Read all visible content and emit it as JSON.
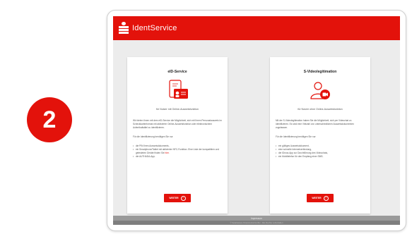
{
  "step": {
    "number": "2"
  },
  "colors": {
    "accent": "#e3120b",
    "page_bg": "#ececec",
    "footer_bg": "#9a9a9a"
  },
  "header": {
    "brand": "IdentService",
    "logo_icon": "sparkasse-logo-icon"
  },
  "cards": [
    {
      "title": "eID-Service",
      "icon": "id-card-icon",
      "subtitle": "für Nutzer mit Online-Ausweisfunktion",
      "paragraph1": "Wir bieten Ihnen mit dem eID-Service die Möglichkeit, sich mit Ihrem Personalausweis im Scheckkartenformat mit aktivierter Online-Ausweisfunktion oder elektronischem Aufenthaltstitel zu identifizieren.",
      "paragraph2": "Für die Identifizierung benötigen Sie nur",
      "list": [
        "die PIN Ihres Ausweisdokuments,",
        "ein Smartphone/Tablet mit aktivierter NFC-Funktion. Eine Liste der kompatiblen und getesteten Geräte finden Sie",
        "die AUTHADA-App."
      ],
      "link_text": "hier",
      "button_label": "WEITER"
    },
    {
      "title": "S-Videolegitimation",
      "icon": "video-user-icon",
      "subtitle": "für Nutzer ohne Online-Ausweisfunktion",
      "paragraph1": "Mit der S-Videolegitimation haben Sie die Möglichkeit, sich per Videochat zu identifizieren. Es sind eine Vielzahl von unterschiedlichen Ausweisdokumenten zugelassen.",
      "paragraph2": "Für die Identifizierung benötigen Sie nur",
      "list": [
        "ein gültiges Ausweisdokument,",
        "eine schnelle Internetverbindung,",
        "die IDnow-App zur Durchführung des Videochats,",
        "ein Mobiltelefon für den Empfang einer SMS."
      ],
      "button_label": "WEITER"
    }
  ],
  "footer": {
    "link": "Impressum",
    "copyright": "© Sparkassen-Finanzportal GmbH · Alle Rechte vorbehalten"
  }
}
